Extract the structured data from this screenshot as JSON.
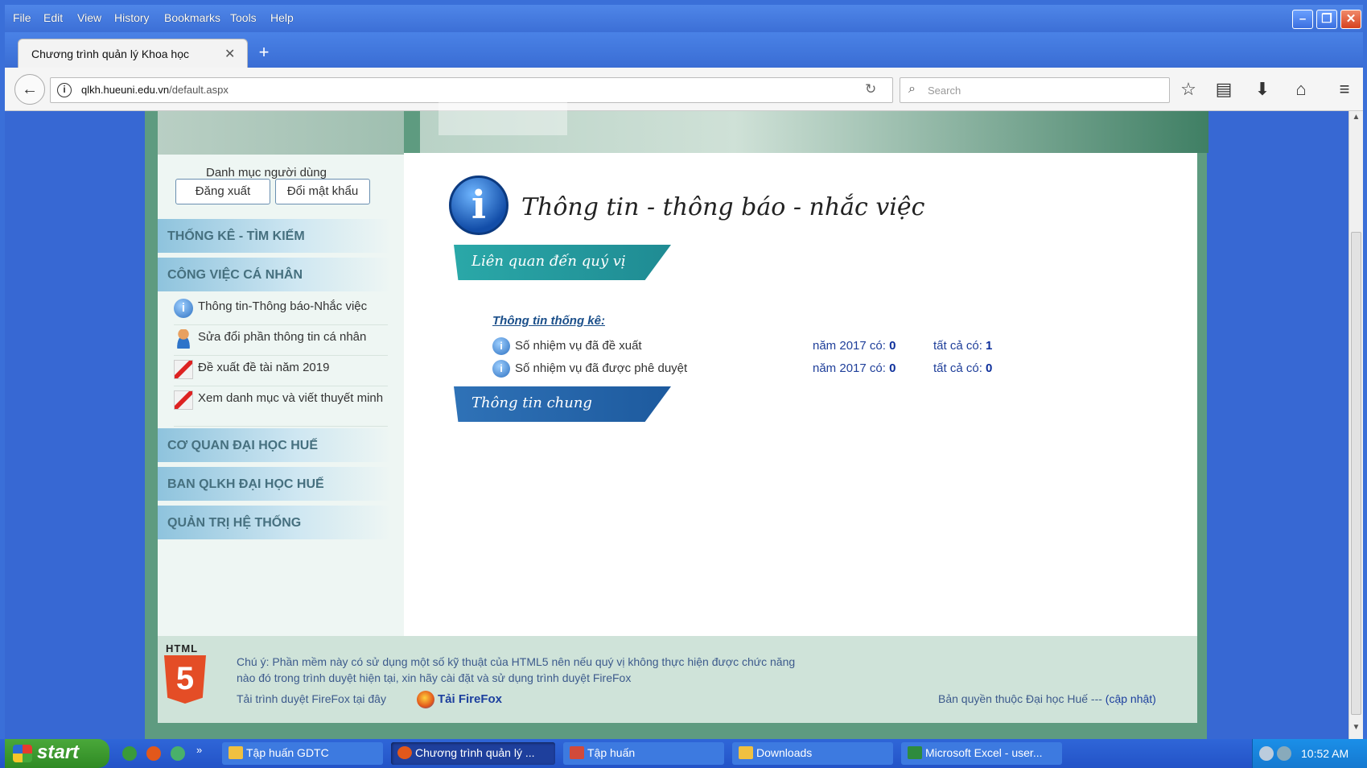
{
  "browser": {
    "menu": [
      "File",
      "Edit",
      "View",
      "History",
      "Bookmarks",
      "Tools",
      "Help"
    ],
    "tab_title": "Chương trình quản lý Khoa học",
    "url_host": "qlkh.hueuni.edu.vn",
    "url_path": "/default.aspx",
    "url_prefix": "",
    "search_placeholder": "Search"
  },
  "sidebar": {
    "title": "Danh mục người dùng",
    "logout": "Đăng xuất",
    "change_password": "Đổi mật khẩu",
    "sections": [
      "THỐNG KÊ - TÌM KIẾM",
      "CÔNG VIỆC CÁ NHÂN",
      "CƠ QUAN ĐẠI HỌC HUẾ",
      "BAN QLKH ĐẠI HỌC HUẾ",
      "QUẢN TRỊ HỆ THỐNG"
    ],
    "items": [
      {
        "label": "Thông tin-Thông báo-Nhắc việc",
        "icon": "info-icon"
      },
      {
        "label": "Sửa đổi phần thông tin cá nhân",
        "icon": "user-icon"
      },
      {
        "label": "Đề xuất đề tài năm 2019",
        "icon": "pen-icon"
      },
      {
        "label": "Xem danh mục và viết thuyết minh",
        "icon": "pen-icon"
      }
    ]
  },
  "content": {
    "title": "Thông tin - thông báo - nhắc việc",
    "ribbon_related": "Liên quan đến quý vị",
    "stats_title": "Thông tin thống kê:",
    "stats": [
      {
        "label": "Số nhiệm vụ đã đề xuất",
        "year_text": "năm 2017 có:",
        "year_value": "0",
        "all_text": "tất cả có:",
        "all_value": "1"
      },
      {
        "label": "Số nhiệm vụ đã được phê duyệt",
        "year_text": "năm 2017 có:",
        "year_value": "0",
        "all_text": "tất cả có:",
        "all_value": "0"
      }
    ],
    "ribbon_general": "Thông tin chung"
  },
  "footer": {
    "html5_label": "HTML",
    "html5_number": "5",
    "note_line1": "Chú ý: Phần mềm này có sử dụng một số kỹ thuật của HTML5 nên nếu quý vị không thực hiện được chức năng",
    "note_line2": "nào đó trong trình duyệt hiện tại, xin hãy cài đặt và sử dụng trình duyệt FireFox",
    "firefox_text": "Tải trình duyệt FireFox tại đây",
    "firefox_link": "Tải FireFox",
    "copyright_text": "Bản quyền thuộc Đại học Huế ---",
    "copyright_link": "(cập nhật)"
  },
  "taskbar": {
    "start": "start",
    "tasks": [
      {
        "label": "Tập huấn GDTC",
        "color": "#f0c040",
        "active": false
      },
      {
        "label": "Chương trình quản lý ...",
        "color": "#e2581b",
        "active": true
      },
      {
        "label": "Tập huấn",
        "color": "#d24a3a",
        "active": false
      },
      {
        "label": "Downloads",
        "color": "#f0c040",
        "active": false
      },
      {
        "label": "Microsoft Excel - user...",
        "color": "#2e8b3e",
        "active": false
      }
    ],
    "clock": "10:52 AM"
  },
  "colors": {
    "xp_blue": "#3a6fd8",
    "site_green": "#5e9b80",
    "ribbon_teal": "#2aa8a8",
    "ribbon_blue": "#2f72b7",
    "link_blue": "#1c3f9e"
  }
}
